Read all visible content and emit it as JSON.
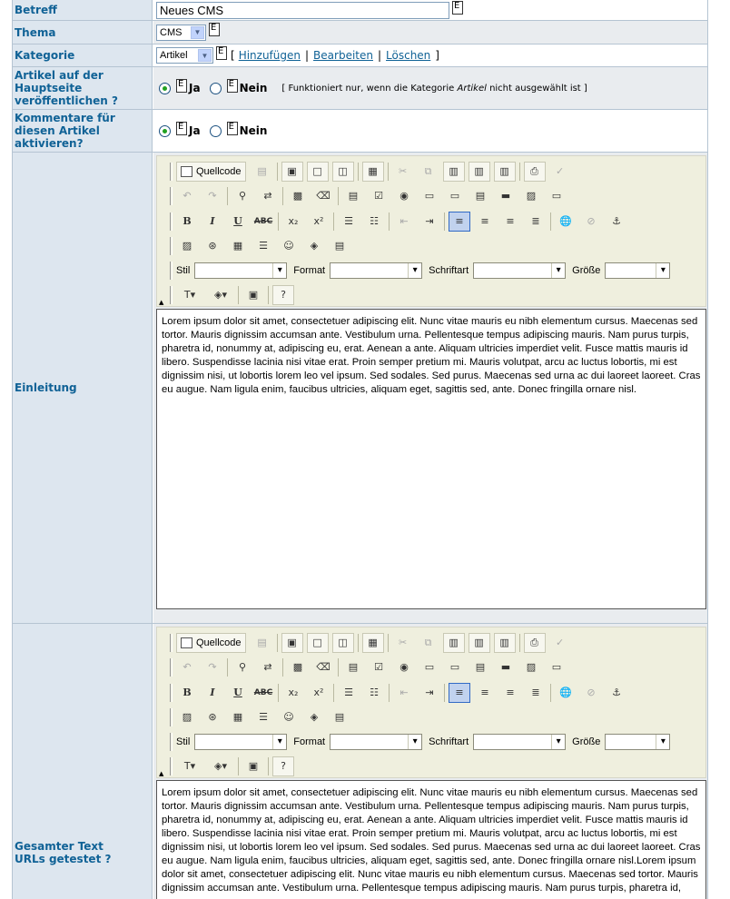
{
  "fields": {
    "betreff": {
      "label": "Betreff",
      "value": "Neues CMS"
    },
    "thema": {
      "label": "Thema",
      "selected": "CMS"
    },
    "kategorie": {
      "label": "Kategorie",
      "selected": "Artikel",
      "bracket_open": "[",
      "bracket_close": "]",
      "separator": "|",
      "links": {
        "add": "Hinzufügen",
        "edit": "Bearbeiten",
        "delete": "Löschen"
      }
    },
    "hauptseite": {
      "label_lines": [
        "Artikel auf der",
        "Hauptseite",
        "veröffentlichen ?"
      ],
      "yes": "Ja",
      "no": "Nein",
      "selected": "yes",
      "note_before": "[ Funktioniert nur, wenn die Kategorie ",
      "note_italic": "Artikel",
      "note_after": " nicht ausgewählt ist ]"
    },
    "kommentare": {
      "label_lines": [
        "Kommentare für",
        "diesen Artikel",
        "aktivieren?"
      ],
      "yes": "Ja",
      "no": "Nein",
      "selected": "yes"
    },
    "einleitung": {
      "label": "Einleitung"
    },
    "gesamter_text": {
      "label_lines": [
        "Gesamter Text",
        "URLs getestet ?"
      ]
    }
  },
  "editor_toolbar": {
    "source_label": "Quellcode",
    "combos": {
      "style": "Stil",
      "format": "Format",
      "font": "Schriftart",
      "size": "Größe"
    },
    "buttons": {
      "bold": "B",
      "italic": "I",
      "underline": "U",
      "strike": "ABC",
      "subscript": "x₂",
      "superscript": "x²",
      "help": "?"
    },
    "icons": [
      "preview-icon",
      "save-icon",
      "new-page-icon",
      "print-icon",
      "cut-icon",
      "copy-icon",
      "paste-icon",
      "undo-icon",
      "redo-icon",
      "find-icon",
      "replace-icon",
      "image-icon",
      "flash-icon",
      "table-icon",
      "smiley-icon",
      "anchor-icon",
      "link-icon",
      "unlink-icon",
      "text-color-icon",
      "bg-color-icon"
    ]
  },
  "editor1_text": "Lorem ipsum dolor sit amet, consectetuer adipiscing elit. Nunc vitae mauris eu nibh elementum cursus. Maecenas sed tortor. Mauris dignissim accumsan ante. Vestibulum urna. Pellentesque tempus adipiscing mauris. Nam purus turpis, pharetra id, nonummy at, adipiscing eu, erat. Aenean a ante. Aliquam ultricies imperdiet velit. Fusce mattis mauris id libero. Suspendisse lacinia nisi vitae erat. Proin semper pretium mi. Mauris volutpat, arcu ac luctus lobortis, mi est dignissim nisi, ut lobortis lorem leo vel ipsum. Sed sodales. Sed purus. Maecenas sed urna ac dui laoreet laoreet. Cras eu augue. Nam ligula enim, faucibus ultricies, aliquam eget, sagittis sed, ante. Donec fringilla ornare nisl.",
  "editor2_text": "Lorem ipsum dolor sit amet, consectetuer adipiscing elit. Nunc vitae mauris eu nibh elementum cursus. Maecenas sed tortor. Mauris dignissim accumsan ante. Vestibulum urna. Pellentesque tempus adipiscing mauris. Nam purus turpis, pharetra id, nonummy at, adipiscing eu, erat. Aenean a ante. Aliquam ultricies imperdiet velit. Fusce mattis mauris id libero. Suspendisse lacinia nisi vitae erat. Proin semper pretium mi. Mauris volutpat, arcu ac luctus lobortis, mi est dignissim nisi, ut lobortis lorem leo vel ipsum. Sed sodales. Sed purus. Maecenas sed urna ac dui laoreet laoreet. Cras eu augue. Nam ligula enim, faucibus ultricies, aliquam eget, sagittis sed, ante. Donec fringilla ornare nisl.Lorem ipsum dolor sit amet, consectetuer adipiscing elit. Nunc vitae mauris eu nibh elementum cursus. Maecenas sed tortor. Mauris dignissim accumsan ante. Vestibulum urna. Pellentesque tempus adipiscing mauris. Nam purus turpis, pharetra id,",
  "colors": {
    "label_bg": "#dde6ef",
    "label_text": "#106296",
    "border": "#b5c4d2",
    "toolbar_bg": "#efefde",
    "radio_dot": "#21a121"
  }
}
